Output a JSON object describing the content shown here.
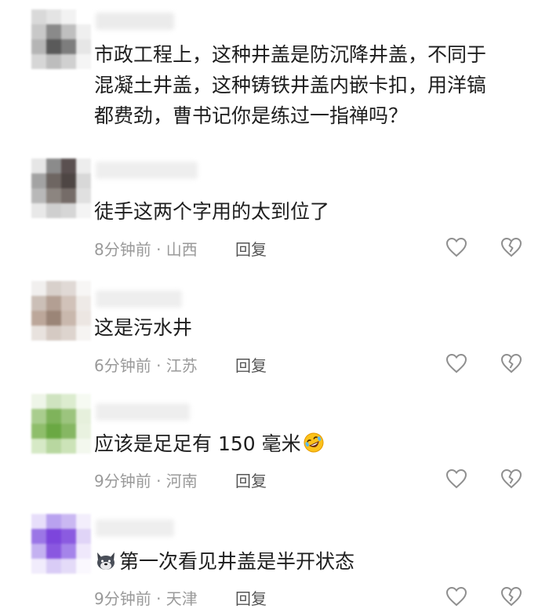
{
  "comments": [
    {
      "lines": [
        "市政工程上，这种井盖是防沉降井盖，不同于",
        "混凝土井盖，这种铸铁井盖内嵌卡扣，用洋镐",
        "都费劲，曹书记你是练过一指禅吗？"
      ],
      "avatar_colors": [
        "#d9d9d9",
        "#e4e4e4",
        "#f2f2f2",
        "#ffffff",
        "#c8c8c8",
        "#8a8a8a",
        "#bfbfbf",
        "#efefef",
        "#b5b5b5",
        "#5a5a5a",
        "#7d7d7d",
        "#e6e6e6",
        "#d6d6d6",
        "#bdbdbd",
        "#d0d0d0",
        "#f5f5f5"
      ]
    },
    {
      "text": "徒手这两个字用的太到位了",
      "time_location": "8分钟前 · 山西",
      "reply": "回复",
      "avatar_colors": [
        "#e6e6e6",
        "#8b8b8b",
        "#5a5050",
        "#ededed",
        "#a3a3a3",
        "#6e6662",
        "#4e4644",
        "#d8d8d8",
        "#b8b8b8",
        "#8c8580",
        "#756c68",
        "#e0e0e0",
        "#e8e8e8",
        "#cfcfcf",
        "#d6d6d6",
        "#f4f4f4"
      ]
    },
    {
      "text": "这是污水井",
      "time_location": "6分钟前 · 江苏",
      "reply": "回复",
      "avatar_colors": [
        "#f1efee",
        "#d8d0cb",
        "#e0d9d5",
        "#f7f6f5",
        "#cbbfb7",
        "#b39f93",
        "#d1c2b9",
        "#eeeae7",
        "#bca79a",
        "#9b8577",
        "#c9b8ad",
        "#ece6e2",
        "#e8e2de",
        "#d5cac3",
        "#ddd4ce",
        "#f6f4f2"
      ]
    },
    {
      "text_before": "应该是足足有 150 毫米",
      "emoji_icon": "rolling-laughing-icon",
      "time_location": "9分钟前 · 河南",
      "reply": "回复",
      "avatar_colors": [
        "#eef5e8",
        "#cfe3c0",
        "#dceccf",
        "#f6faf2",
        "#a9cd8e",
        "#7fb35b",
        "#9cc47e",
        "#e6f0dc",
        "#8fbe6b",
        "#6aa843",
        "#86b763",
        "#e9f2e0",
        "#d6e9c6",
        "#b8d7a0",
        "#cce3b8",
        "#f3f8ee"
      ]
    },
    {
      "text_after_icon": "第一次看见井盖是半开状态",
      "badge_icon": "dog-emoji-icon",
      "time_location": "9分钟前 · 天津",
      "reply": "回复",
      "avatar_colors": [
        "#e7defa",
        "#b9a2ef",
        "#cab8f2",
        "#f3eefc",
        "#9b76e6",
        "#7d45dc",
        "#8b5be0",
        "#e0d4f7",
        "#c4b1f1",
        "#8a58e0",
        "#a584ea",
        "#efe8fb",
        "#f1ecfc",
        "#d9ccf6",
        "#e4dbf8",
        "#faf8fe"
      ]
    }
  ],
  "icons": {
    "like": "heart-outline-icon",
    "dislike": "broken-heart-icon"
  },
  "colors": {
    "text": "#1e1e1e",
    "meta": "#9a9a9a",
    "reply": "#555555",
    "icon_stroke": "#8f8f8f"
  }
}
